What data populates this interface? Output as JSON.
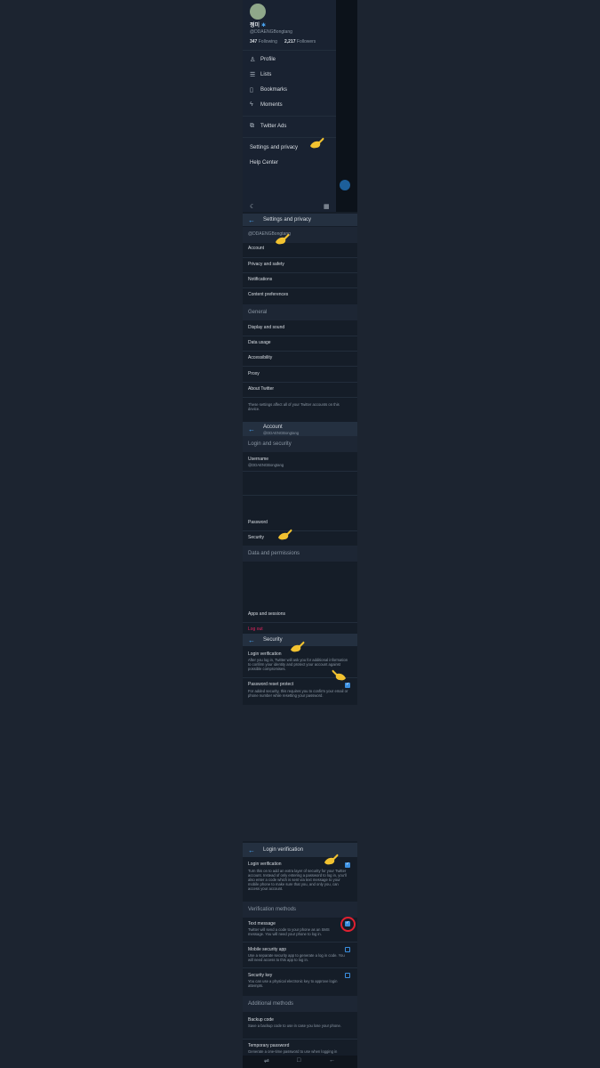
{
  "drawer": {
    "display_name": "쩡미",
    "handle": "@DDAENGBongtang",
    "following_count": "347",
    "following_label": "Following",
    "followers_count": "2,217",
    "followers_label": "Followers",
    "menu": [
      "Profile",
      "Lists",
      "Bookmarks",
      "Moments"
    ],
    "ads": "Twitter Ads",
    "settings": "Settings and privacy",
    "help": "Help Center"
  },
  "settings_privacy": {
    "title": "Settings and privacy",
    "handle": "@DDAENGBongtang",
    "items": [
      "Account",
      "Privacy and safety",
      "Notifications",
      "Content preferences"
    ],
    "general_header": "General",
    "general_items": [
      "Display and sound",
      "Data usage",
      "Accessibility",
      "Proxy",
      "About Twitter"
    ],
    "footnote": "These settings affect all of your Twitter accounts on this device."
  },
  "account": {
    "title": "Account",
    "subtitle": "@DDAENGBongtang",
    "login_header": "Login and security",
    "username_label": "Username",
    "username_value": "@DDAENGBongtang",
    "password": "Password",
    "security": "Security",
    "data_header": "Data and permissions",
    "apps": "Apps and sessions",
    "logout": "Log out"
  },
  "security": {
    "title": "Security",
    "login_verification_label": "Login verification",
    "login_verification_desc": "After you log in, Twitter will ask you for additional information to confirm your identity and protect your account against possible compromises.",
    "reset_protect_label": "Password reset protect",
    "reset_protect_desc": "For added security, this requires you to confirm your email or phone number while resetting your password."
  },
  "login_verification": {
    "title": "Login verification",
    "lv_label": "Login verification",
    "lv_desc": "Turn this on to add an extra layer of security for your Twitter account. Instead of only entering a password to log in, you'll also enter a code which is sent via text message to your mobile phone to make sure that you, and only you, can access your account.",
    "methods_header": "Verification methods",
    "text_label": "Text message",
    "text_desc": "Twitter will send a code to your phone as an SMS message. You will need your phone to log in.",
    "app_label": "Mobile security app",
    "app_desc": "Use a separate security app to generate a log in code. You will need access to this app to log in.",
    "key_label": "Security key",
    "key_desc": "You can use a physical electronic key to approve login attempts.",
    "additional_header": "Additional methods",
    "backup_label": "Backup code",
    "backup_desc": "Save a backup code to use in case you lose your phone.",
    "temp_label": "Temporary password",
    "temp_desc": "Generate a one-time password to use when logging in"
  },
  "colors": {
    "background": "#1c2430",
    "panel": "#151d28",
    "accent": "#3b8fe0",
    "logout": "#e0245e",
    "highlight": "#e02030",
    "hand": "#f2c230"
  }
}
